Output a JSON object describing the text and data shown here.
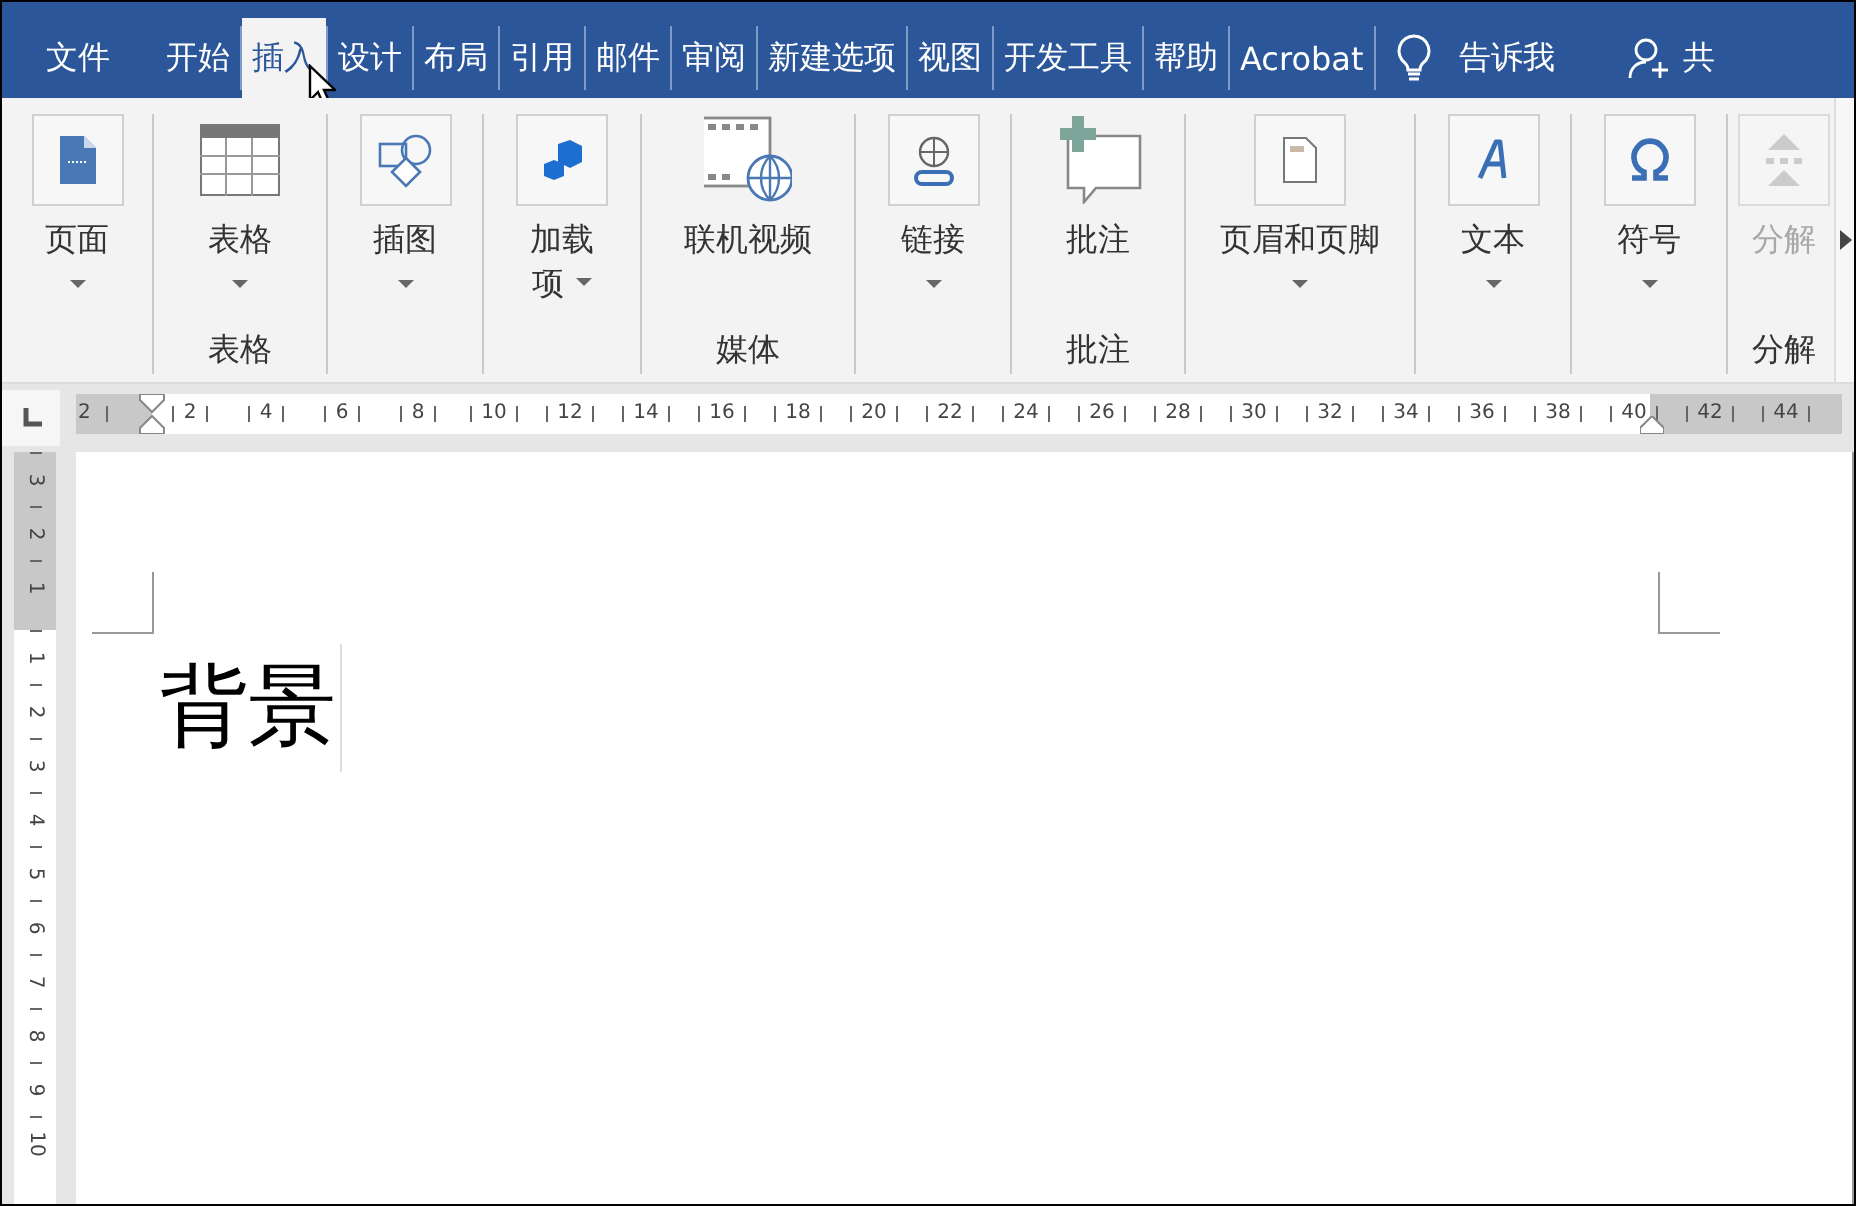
{
  "tabs": [
    {
      "label": "文件",
      "selected": false
    },
    {
      "label": "开始",
      "selected": false
    },
    {
      "label": "插入",
      "selected": true
    },
    {
      "label": "设计",
      "selected": false
    },
    {
      "label": "布局",
      "selected": false
    },
    {
      "label": "引用",
      "selected": false
    },
    {
      "label": "邮件",
      "selected": false
    },
    {
      "label": "审阅",
      "selected": false
    },
    {
      "label": "新建选项",
      "selected": false
    },
    {
      "label": "视图",
      "selected": false
    },
    {
      "label": "开发工具",
      "selected": false
    },
    {
      "label": "帮助",
      "selected": false
    },
    {
      "label": "Acrobat",
      "selected": false
    }
  ],
  "tell_me": {
    "label": "告诉我"
  },
  "share": {
    "label": "共"
  },
  "ribbon": {
    "groups": [
      {
        "buttons": [
          {
            "label": "页面",
            "dropdown": true,
            "disabled": false
          }
        ]
      },
      {
        "label": "表格",
        "buttons": [
          {
            "label": "表格",
            "dropdown": true,
            "disabled": false
          }
        ]
      },
      {
        "buttons": [
          {
            "label": "插图",
            "dropdown": true,
            "disabled": false
          }
        ]
      },
      {
        "buttons": [
          {
            "label": "加载项",
            "dropdown": true,
            "disabled": false
          }
        ]
      },
      {
        "label": "媒体",
        "buttons": [
          {
            "label": "联机视频",
            "dropdown": false,
            "disabled": false
          }
        ]
      },
      {
        "buttons": [
          {
            "label": "链接",
            "dropdown": true,
            "disabled": false
          }
        ]
      },
      {
        "label": "批注",
        "buttons": [
          {
            "label": "批注",
            "dropdown": false,
            "disabled": false
          }
        ]
      },
      {
        "buttons": [
          {
            "label": "页眉和页脚",
            "dropdown": true,
            "disabled": false
          }
        ]
      },
      {
        "buttons": [
          {
            "label": "文本",
            "dropdown": true,
            "disabled": false
          }
        ]
      },
      {
        "buttons": [
          {
            "label": "符号",
            "dropdown": true,
            "disabled": false
          }
        ]
      },
      {
        "label": "分解",
        "buttons": [
          {
            "label": "分解",
            "dropdown": false,
            "disabled": true
          }
        ]
      }
    ]
  },
  "ruler": {
    "horizontal": [
      "2",
      "2",
      "4",
      "6",
      "8",
      "10",
      "12",
      "14",
      "16",
      "18",
      "20",
      "22",
      "24",
      "26",
      "28",
      "30",
      "32",
      "34",
      "36",
      "38",
      "40",
      "42",
      "44"
    ],
    "vertical": [
      "3",
      "2",
      "1",
      "1",
      "2",
      "3",
      "4",
      "5",
      "6",
      "7",
      "8",
      "9",
      "10"
    ]
  },
  "document": {
    "text": "背景"
  }
}
